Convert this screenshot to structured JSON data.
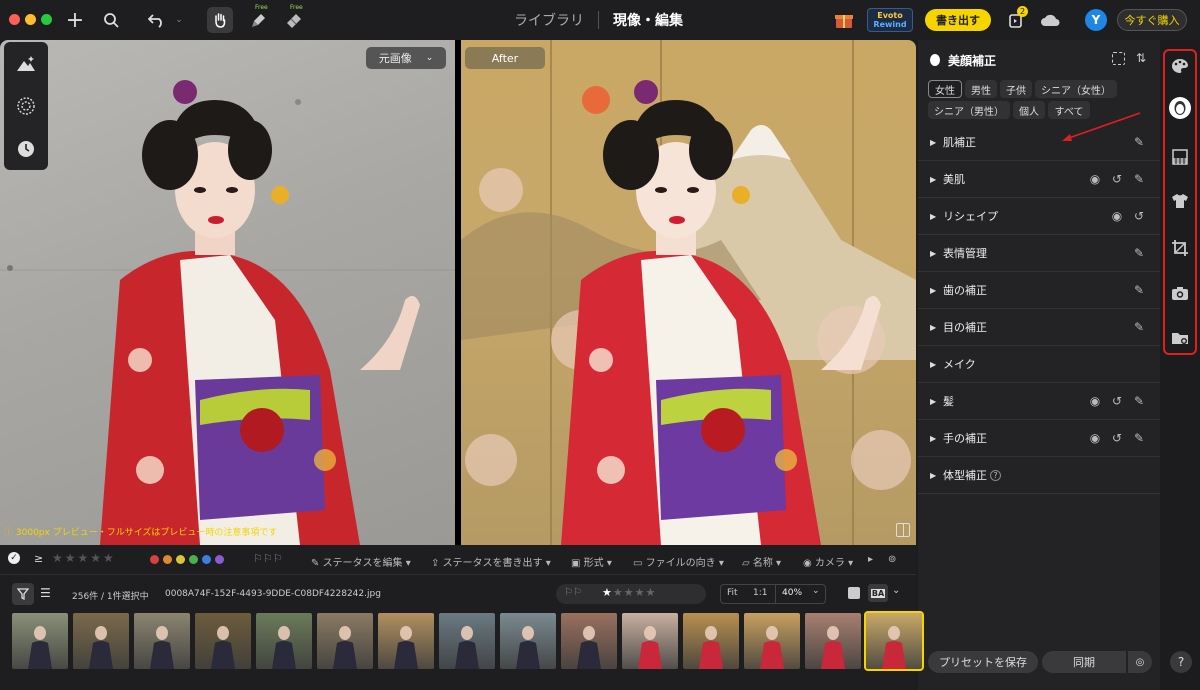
{
  "topbar": {
    "tabs": [
      "ライブラリ",
      "現像・編集"
    ],
    "active_tab": 1,
    "free_badge_1": "Free",
    "free_badge_2": "Free",
    "rewind_line1": "Evoto",
    "rewind_line2": "Rewind",
    "export_button": "書き出す",
    "badge_count": "2",
    "avatar_letter": "Y",
    "buy_button": "今すぐ購入"
  },
  "viewer": {
    "before_label": "元画像",
    "after_label": "After",
    "preview_note": "3000px プレビュー・フルサイズはプレビュー時の注意事項です"
  },
  "panel": {
    "title": "美顔補正",
    "presets": [
      "女性",
      "男性",
      "子供",
      "シニア（女性）",
      "シニア（男性）",
      "個人",
      "すべて"
    ],
    "active_preset": 0,
    "sections": [
      {
        "label": "肌補正",
        "icons": [
          "edit"
        ]
      },
      {
        "label": "美肌",
        "icons": [
          "eye",
          "reset",
          "edit"
        ]
      },
      {
        "label": "リシェイプ",
        "icons": [
          "eye",
          "reset"
        ]
      },
      {
        "label": "表情管理",
        "icons": [
          "edit"
        ]
      },
      {
        "label": "歯の補正",
        "icons": [
          "edit"
        ]
      },
      {
        "label": "目の補正",
        "icons": [
          "edit"
        ]
      },
      {
        "label": "メイク",
        "icons": []
      },
      {
        "label": "髪",
        "icons": [
          "eye",
          "reset",
          "edit"
        ]
      },
      {
        "label": "手の補正",
        "icons": [
          "eye",
          "reset",
          "edit"
        ]
      },
      {
        "label": "体型補正",
        "icons": [
          "info"
        ]
      }
    ],
    "save_preset": "プリセットを保存",
    "sync": "同期"
  },
  "rating_bar": {
    "filter_symbol": "≥",
    "edit_status": "ステータスを編集",
    "export_status": "ステータスを書き出す",
    "format": "形式",
    "orientation": "ファイルの向き",
    "name": "名称",
    "camera": "カメラ",
    "label_colors": [
      "#d94040",
      "#e08a30",
      "#d8c53a",
      "#4caf50",
      "#3d7fe0",
      "#8a5cd0"
    ]
  },
  "info_bar": {
    "count": "256件 / 1件選択中",
    "filename": "0008A74F-152F-4493-9DDE-C08DF4228242.jpg",
    "fit": "Fit",
    "one_to_one": "1:1",
    "zoom": "40%",
    "ba_label": "BA"
  },
  "thumbnails": [
    {
      "color": "#8a9078"
    },
    {
      "color": "#7a6a4a"
    },
    {
      "color": "#8b8470"
    },
    {
      "color": "#6d5c3c"
    },
    {
      "color": "#6b7b5a"
    },
    {
      "color": "#8a7a62"
    },
    {
      "color": "#b09060"
    },
    {
      "color": "#6a7a82"
    },
    {
      "color": "#7a8a90"
    },
    {
      "color": "#9a7060"
    },
    {
      "color": "#c8b0a0"
    },
    {
      "color": "#b89050"
    },
    {
      "color": "#c8a060"
    },
    {
      "color": "#a88070"
    },
    {
      "color": "#c8a868"
    }
  ],
  "selected_thumbnail": 14,
  "help": "?"
}
